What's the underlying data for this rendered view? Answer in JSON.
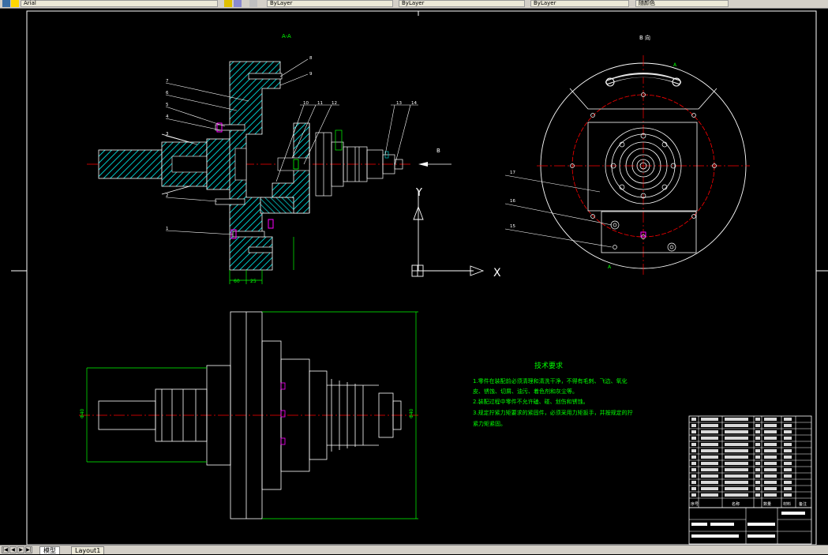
{
  "toolbar": {
    "items": [
      {
        "label": "Arial"
      },
      {
        "label": "ByLayer"
      },
      {
        "label": "ByLayer"
      },
      {
        "label": "ByLayer"
      },
      {
        "label": "随颜色"
      }
    ]
  },
  "drawing": {
    "view_a_title": "A-A",
    "view_b_title": "B 向",
    "section_label_a": "A",
    "arrow_label_b": "B",
    "ucs_x": "X",
    "ucs_y": "Y",
    "dim_width_1": "60",
    "dim_width_2": "25",
    "dim_height_left": "Φ40",
    "dim_height_right": "Φ40",
    "tech_title": "技术要求",
    "tech_lines": [
      "1.零件在装配前必须清理和清洗干净，不得有毛刺、飞边、氧化",
      "皮、锈蚀、切屑、油污、着色剂和灰尘等。",
      "2.装配过程中零件不允许磕、碰、划伤和锈蚀。",
      "3.规定拧紧力矩要求的紧固件，必须采用力矩扳手，并按规定的拧",
      "紧力矩紧固。"
    ],
    "balloons_left": [
      "8",
      "9",
      "7",
      "6",
      "5",
      "4",
      "3",
      "2",
      "1",
      "10",
      "11",
      "12",
      "13",
      "14"
    ],
    "balloons_right": [
      "17",
      "16",
      "15"
    ],
    "titleblock_headers": [
      "序号",
      "名称",
      "数量",
      "材料",
      "备注"
    ]
  },
  "statusbar": {
    "tabs": [
      {
        "label": "模型"
      },
      {
        "label": "Layout1"
      }
    ]
  },
  "colors": {
    "background": "#000000",
    "border": "#ffffff",
    "section_fill": "#00c8c8",
    "centerline": "#ff0000",
    "dimension": "#00ff00",
    "annotation": "#00ff00",
    "balloon_marker": "#ff00ff"
  }
}
